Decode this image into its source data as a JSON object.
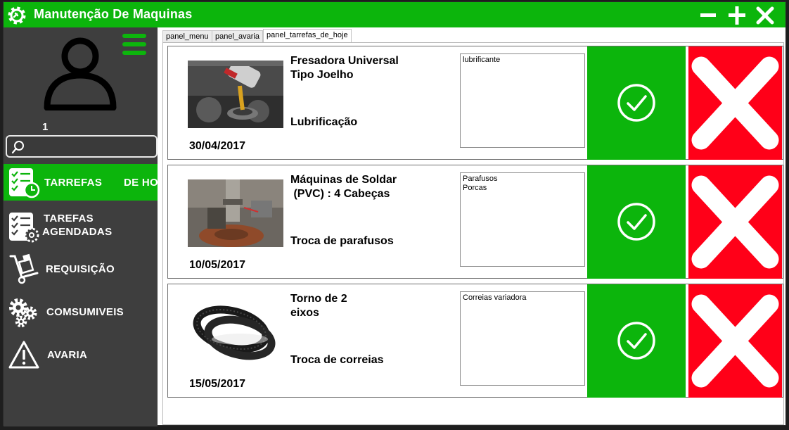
{
  "app": {
    "title": "Manutenção De Maquinas"
  },
  "colors": {
    "accent": "#0cb50c",
    "sidebar": "#3e3e3e",
    "cancel": "#ff0018"
  },
  "user": {
    "id": "1"
  },
  "search": {
    "placeholder": ""
  },
  "sidebar": {
    "items": [
      {
        "label": "TARREFAS",
        "label2": "DE HO",
        "icon": "checklist-clock-icon",
        "active": true
      },
      {
        "label": "TAREFAS",
        "label2": "AGENDADAS",
        "icon": "checklist-gear-icon",
        "active": false
      },
      {
        "label": "REQUISIÇÃO",
        "icon": "hand-truck-icon",
        "active": false
      },
      {
        "label": "COMSUMIVEIS",
        "icon": "gears-icon",
        "active": false
      },
      {
        "label": "AVARIA",
        "icon": "warning-icon",
        "active": false
      }
    ]
  },
  "tabs": [
    {
      "label": "panel_menu"
    },
    {
      "label": "panel_avaria"
    },
    {
      "label": "panel_tarrefas_de_hoje",
      "selected": true
    }
  ],
  "tasks": [
    {
      "name": "Fresadora Universal\nTipo Joelho",
      "type": "Lubrificação",
      "date": "30/04/2017",
      "materials": [
        "lubrificante"
      ],
      "image": "oil-pouring-image"
    },
    {
      "name": "Máquinas de Soldar\n (PVC) : 4 Cabeças",
      "type": "Troca de parafusos",
      "date": "10/05/2017",
      "materials": [
        "Parafusos",
        "Porcas"
      ],
      "image": "brake-disc-image"
    },
    {
      "name": "Torno de 2\neixos",
      "type": "Troca de correias",
      "date": "15/05/2017",
      "materials": [
        "Correias variadora"
      ],
      "image": "drive-belt-image"
    }
  ]
}
